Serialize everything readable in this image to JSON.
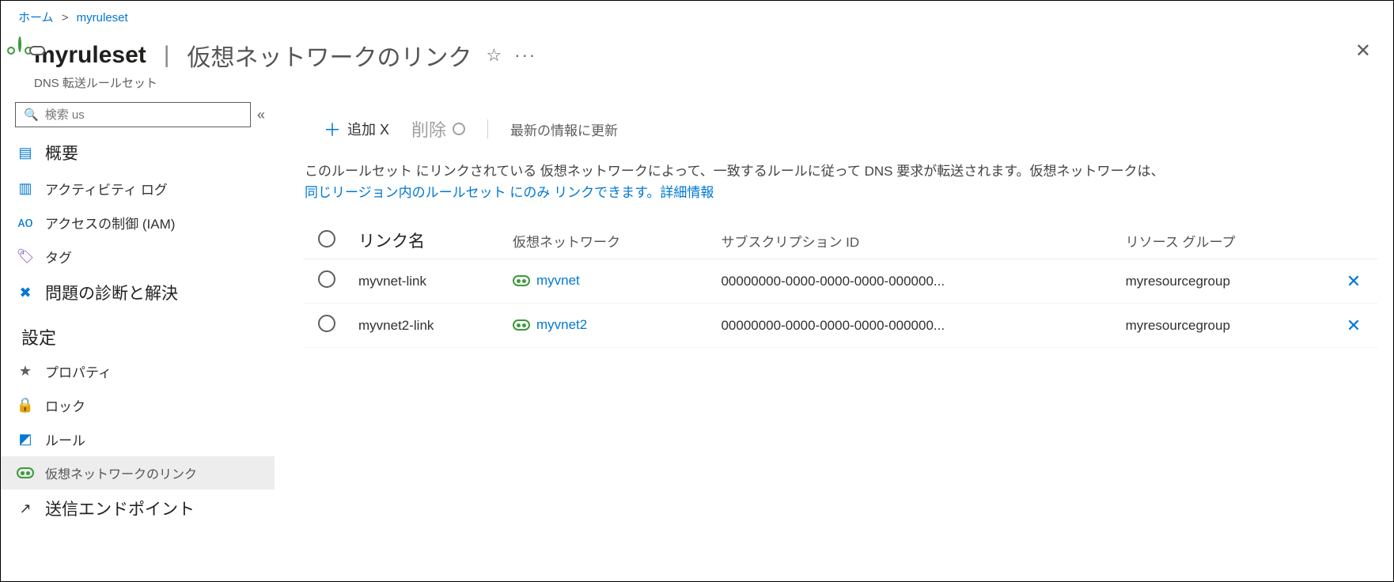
{
  "breadcrumb": {
    "home": "ホーム",
    "resource": "myruleset"
  },
  "header": {
    "name": "myruleset",
    "page": "仮想ネットワークのリンク",
    "subtitle": "DNS 転送ルールセット"
  },
  "search": {
    "placeholder": "検索 us"
  },
  "sidebar": {
    "overview": "概要",
    "activity": "アクティビティ ログ",
    "iam": "アクセスの制御 (IAM)",
    "tags": "タグ",
    "diagnose": "問題の診断と解決",
    "settings_header": "設定",
    "properties": "プロパティ",
    "lock": "ロック",
    "rules": "ルール",
    "vnetlinks": "仮想ネットワークのリンク",
    "outbound": "送信エンドポイント"
  },
  "toolbar": {
    "add": "追加 X",
    "delete": "削除",
    "refresh": "最新の情報に更新"
  },
  "desc": {
    "line1": "このルールセット にリンクされている 仮想ネットワークによって、一致するルールに従って DNS 要求が転送されます。仮想ネットワークは、",
    "link": "同じリージョン内のルールセット にのみ リンクできます。詳細情報"
  },
  "columns": {
    "linkname": "リンク名",
    "vnet": "仮想ネットワーク",
    "sub": "サブスクリプション ID",
    "rg": "リソース グループ"
  },
  "rows": [
    {
      "linkname": "myvnet-link",
      "vnet": "myvnet",
      "sub": "00000000-0000-0000-0000-000000...",
      "rg": "myresourcegroup"
    },
    {
      "linkname": "myvnet2-link",
      "vnet": "myvnet2",
      "sub": "00000000-0000-0000-0000-000000...",
      "rg": "myresourcegroup"
    }
  ]
}
